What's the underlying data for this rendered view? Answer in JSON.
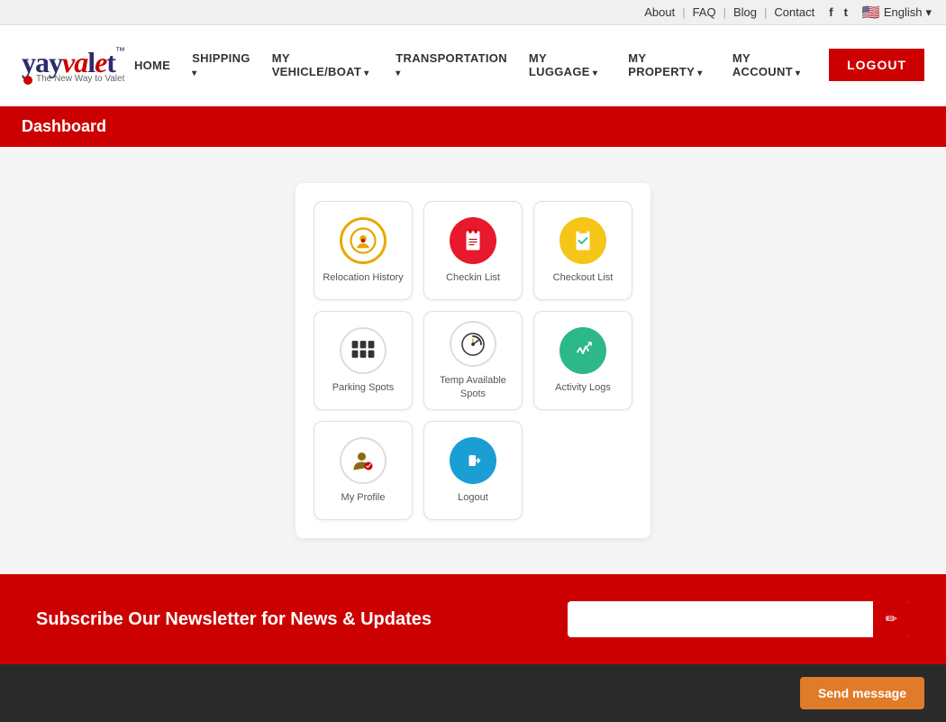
{
  "topbar": {
    "links": [
      "About",
      "FAQ",
      "Blog",
      "Contact"
    ],
    "social": [
      "f",
      "t"
    ],
    "language": "English"
  },
  "header": {
    "logo": "yayvalet",
    "logo_tm": "™",
    "logo_sub": "The New Way to Valet",
    "nav": [
      {
        "label": "HOME",
        "dropdown": false
      },
      {
        "label": "SHIPPING",
        "dropdown": true
      },
      {
        "label": "MY VEHICLE/BOAT",
        "dropdown": true
      },
      {
        "label": "TRANSPORTATION",
        "dropdown": true
      },
      {
        "label": "MY LUGGAGE",
        "dropdown": true
      },
      {
        "label": "MY PROPERTY",
        "dropdown": true
      },
      {
        "label": "MY ACCOUNT",
        "dropdown": true
      }
    ],
    "logout_label": "LOGOUT"
  },
  "dashboard": {
    "title": "Dashboard",
    "grid_items": [
      {
        "id": "relocation-history",
        "label": "Relocation History",
        "icon_type": "relocation"
      },
      {
        "id": "checkin-list",
        "label": "Checkin List",
        "icon_type": "checkin"
      },
      {
        "id": "checkout-list",
        "label": "Checkout List",
        "icon_type": "checkout"
      },
      {
        "id": "parking-spots",
        "label": "Parking Spots",
        "icon_type": "parking"
      },
      {
        "id": "temp-available-spots",
        "label": "Temp Available Spots",
        "icon_type": "temp"
      },
      {
        "id": "activity-logs",
        "label": "Activity Logs",
        "icon_type": "activity"
      },
      {
        "id": "my-profile",
        "label": "My Profile",
        "icon_type": "profile"
      },
      {
        "id": "logout",
        "label": "Logout",
        "icon_type": "logout"
      }
    ]
  },
  "newsletter": {
    "text": "Subscribe Our Newsletter for News & Updates",
    "input_placeholder": "",
    "button_icon": "✏"
  },
  "footer": {
    "send_message_label": "Send message"
  }
}
